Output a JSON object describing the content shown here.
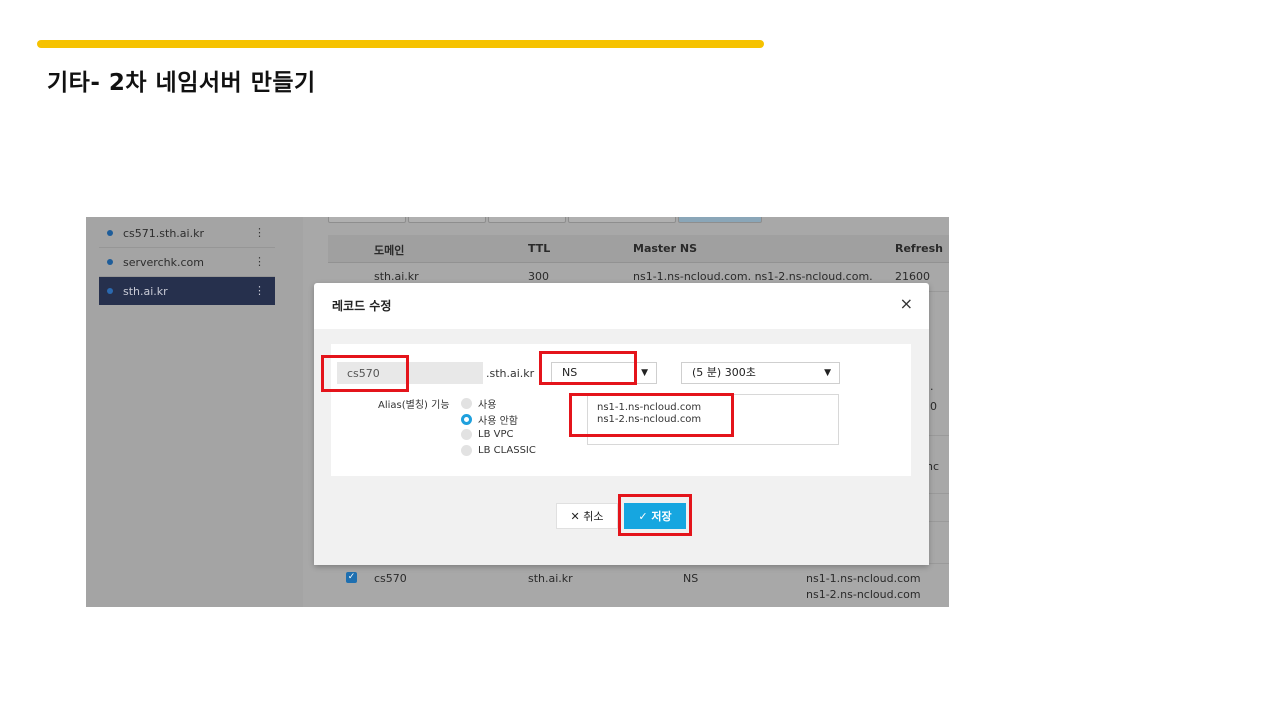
{
  "slide": {
    "title": "기타- 2차 네임서버 만들기"
  },
  "sidebar": {
    "items": [
      {
        "label": "cs571.sth.ai.kr"
      },
      {
        "label": "serverchk.com"
      },
      {
        "label": "sth.ai.kr"
      }
    ],
    "kebab_glyph": "⋮"
  },
  "table": {
    "headers": {
      "domain": "도메인",
      "ttl": "TTL",
      "master_ns": "Master NS",
      "refresh": "Refresh"
    },
    "row1": {
      "domain": "sth.ai.kr",
      "ttl": "300",
      "master_ns": "ns1-1.ns-ncloud.com. ns1-2.ns-ncloud.com.",
      "refresh": "21600"
    },
    "partial": {
      "a": ".",
      "b": "0",
      "c": "nc"
    },
    "record_row": {
      "name": "cs570",
      "zone": "sth.ai.kr",
      "type": "NS",
      "value1": "ns1-1.ns-ncloud.com",
      "value2": "ns1-2.ns-ncloud.com"
    }
  },
  "modal": {
    "title": "레코드 수정",
    "close_glyph": "×",
    "name_value": "cs570",
    "zone_suffix": ".sth.ai.kr",
    "type_value": "NS",
    "ttl_value": "(5 분) 300초",
    "alias_label": "Alias(별칭) 기능",
    "alias_options": [
      "사용",
      "사용 안함",
      "LB VPC",
      "LB CLASSIC"
    ],
    "record_values": [
      "ns1-1.ns-ncloud.com",
      "ns1-2.ns-ncloud.com"
    ],
    "cancel_label": "✕ 취소",
    "save_label": "✓ 저장"
  },
  "colors": {
    "accent": "#f6c200",
    "highlight": "#e4141b",
    "save_button": "#16a6e0",
    "sidebar_selected": "#26304d"
  }
}
